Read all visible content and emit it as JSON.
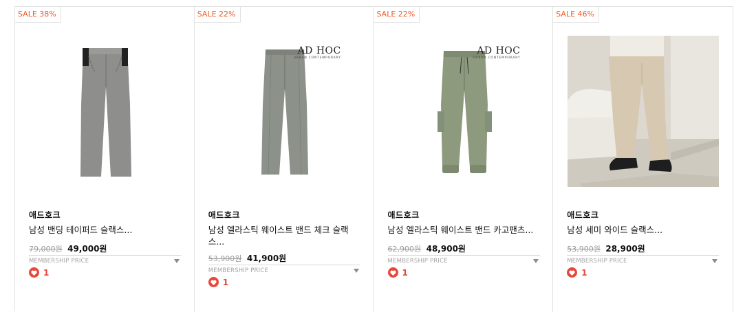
{
  "products": [
    {
      "badge": "SALE 38%",
      "brand": "애드호크",
      "name": "남성 밴딩 테이퍼드 슬랙스...",
      "original_price": "79,000원",
      "sale_price": "49,000원",
      "membership_label": "MEMBERSHIP PRICE",
      "likes": "1",
      "image": "grey-tapered-slacks"
    },
    {
      "badge": "SALE 22%",
      "brand": "애드호크",
      "name": "남성 엘라스틱 웨이스트 밴드 체크 슬랙스...",
      "original_price": "53,900원",
      "sale_price": "41,900원",
      "membership_label": "MEMBERSHIP PRICE",
      "likes": "1",
      "logo": "AD HOC",
      "logo_sub": "URBAN CONTEMPORARY",
      "image": "check-slacks"
    },
    {
      "badge": "SALE 22%",
      "brand": "애드호크",
      "name": "남성 엘라스틱 웨이스트 밴드 카고팬츠...",
      "original_price": "62,900원",
      "sale_price": "48,900원",
      "membership_label": "MEMBERSHIP PRICE",
      "likes": "1",
      "logo": "AD HOC",
      "logo_sub": "URBAN CONTEMPORARY",
      "image": "khaki-cargo-pants"
    },
    {
      "badge": "SALE 46%",
      "brand": "애드호크",
      "name": "남성 세미 와이드 슬랙스...",
      "original_price": "53,900원",
      "sale_price": "28,900원",
      "membership_label": "MEMBERSHIP PRICE",
      "likes": "1",
      "image": "beige-wide-slacks-lifestyle"
    }
  ],
  "colors": {
    "sale_badge": "#f05a28",
    "heart": "#e8473b",
    "muted": "#9a9a9a"
  },
  "icons": {
    "like": "heart-icon",
    "expand": "triangle-down-icon"
  }
}
